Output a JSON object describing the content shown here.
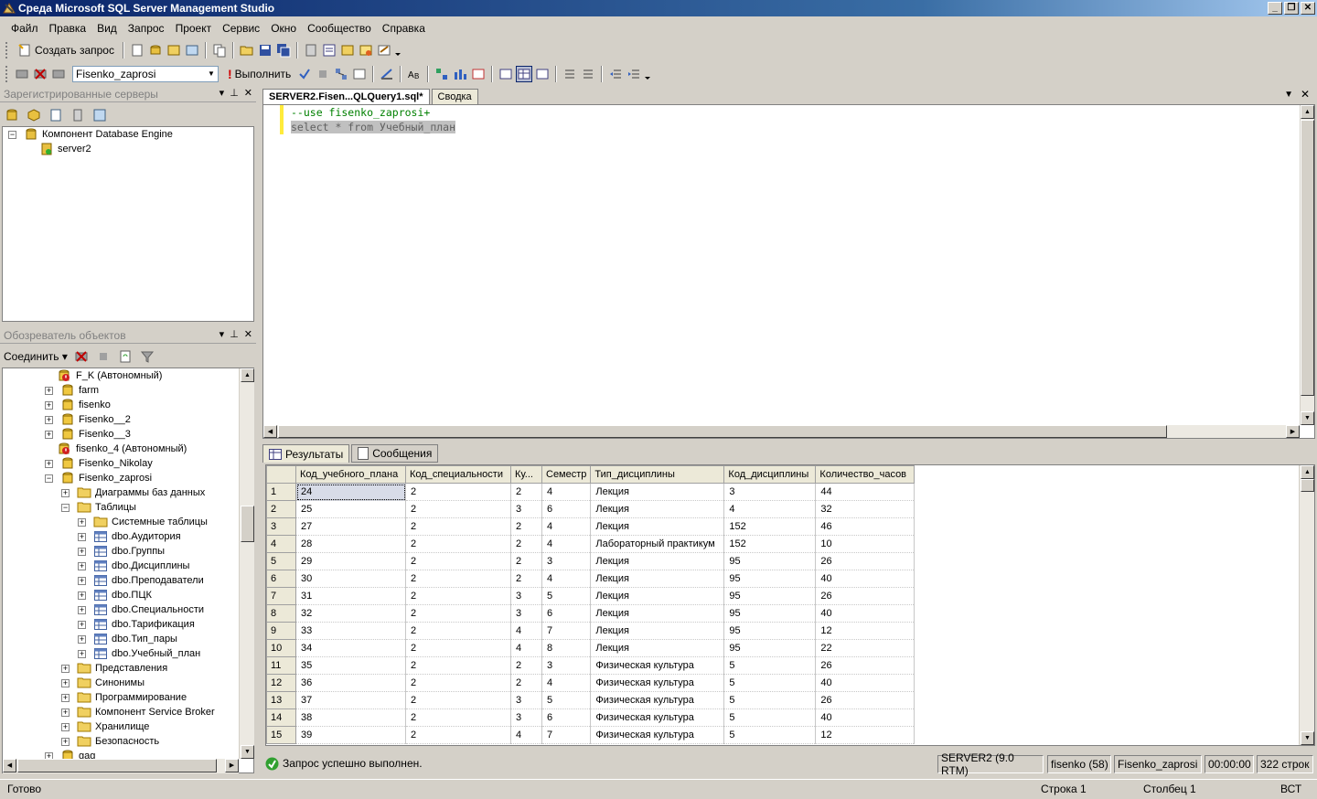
{
  "window": {
    "title": "Среда Microsoft SQL Server Management Studio"
  },
  "menu": [
    "Файл",
    "Правка",
    "Вид",
    "Запрос",
    "Проект",
    "Сервис",
    "Окно",
    "Сообщество",
    "Справка"
  ],
  "toolbar1": {
    "new_query": "Создать запрос"
  },
  "toolbar2": {
    "database": "Fisenko_zaprosi",
    "execute": "Выполнить"
  },
  "registered_servers": {
    "title": "Зарегистрированные серверы",
    "items": [
      {
        "label": "Компонент Database Engine",
        "expander": "−"
      },
      {
        "label": "server2",
        "expander": ""
      }
    ]
  },
  "object_explorer": {
    "title": "Обозреватель объектов",
    "connect": "Соединить",
    "items": [
      {
        "label": "F_K (Автономный)",
        "expander": "",
        "icon": "db-offline"
      },
      {
        "label": "farm",
        "expander": "+",
        "icon": "db"
      },
      {
        "label": "fisenko",
        "expander": "+",
        "icon": "db"
      },
      {
        "label": "Fisenko__2",
        "expander": "+",
        "icon": "db"
      },
      {
        "label": "Fisenko__3",
        "expander": "+",
        "icon": "db"
      },
      {
        "label": "fisenko_4 (Автономный)",
        "expander": "",
        "icon": "db-offline"
      },
      {
        "label": "Fisenko_Nikolay",
        "expander": "+",
        "icon": "db"
      },
      {
        "label": "Fisenko_zaprosi",
        "expander": "−",
        "icon": "db"
      },
      {
        "label": "Диаграммы баз данных",
        "expander": "+",
        "icon": "folder"
      },
      {
        "label": "Таблицы",
        "expander": "−",
        "icon": "folder"
      },
      {
        "label": "Системные таблицы",
        "expander": "+",
        "icon": "folder"
      },
      {
        "label": "dbo.Аудитория",
        "expander": "+",
        "icon": "table"
      },
      {
        "label": "dbo.Группы",
        "expander": "+",
        "icon": "table"
      },
      {
        "label": "dbo.Дисциплины",
        "expander": "+",
        "icon": "table"
      },
      {
        "label": "dbo.Преподаватели",
        "expander": "+",
        "icon": "table"
      },
      {
        "label": "dbo.ПЦК",
        "expander": "+",
        "icon": "table"
      },
      {
        "label": "dbo.Специальности",
        "expander": "+",
        "icon": "table"
      },
      {
        "label": "dbo.Тарификация",
        "expander": "+",
        "icon": "table"
      },
      {
        "label": "dbo.Тип_пары",
        "expander": "+",
        "icon": "table"
      },
      {
        "label": "dbo.Учебный_план",
        "expander": "+",
        "icon": "table"
      },
      {
        "label": "Представления",
        "expander": "+",
        "icon": "folder"
      },
      {
        "label": "Синонимы",
        "expander": "+",
        "icon": "folder"
      },
      {
        "label": "Программирование",
        "expander": "+",
        "icon": "folder"
      },
      {
        "label": "Компонент Service Broker",
        "expander": "+",
        "icon": "folder"
      },
      {
        "label": "Хранилище",
        "expander": "+",
        "icon": "folder"
      },
      {
        "label": "Безопасность",
        "expander": "+",
        "icon": "folder"
      },
      {
        "label": "gag",
        "expander": "+",
        "icon": "db"
      }
    ]
  },
  "editor": {
    "tabs": [
      "SERVER2.Fisen...QLQuery1.sql*",
      "Сводка"
    ],
    "lines": [
      "--use fisenko_zaprosi+",
      "select * from Учебный_план"
    ]
  },
  "results": {
    "tabs": [
      "Результаты",
      "Сообщения"
    ],
    "columns": [
      "Код_учебного_плана",
      "Код_специальности",
      "Ку...",
      "Семестр",
      "Тип_дисциплины",
      "Код_дисциплины",
      "Количество_часов"
    ],
    "rows": [
      [
        "1",
        "24",
        "2",
        "2",
        "4",
        "Лекция",
        "3",
        "44"
      ],
      [
        "2",
        "25",
        "2",
        "3",
        "6",
        "Лекция",
        "4",
        "32"
      ],
      [
        "3",
        "27",
        "2",
        "2",
        "4",
        "Лекция",
        "152",
        "46"
      ],
      [
        "4",
        "28",
        "2",
        "2",
        "4",
        "Лабораторный практикум",
        "152",
        "10"
      ],
      [
        "5",
        "29",
        "2",
        "2",
        "3",
        "Лекция",
        "95",
        "26"
      ],
      [
        "6",
        "30",
        "2",
        "2",
        "4",
        "Лекция",
        "95",
        "40"
      ],
      [
        "7",
        "31",
        "2",
        "3",
        "5",
        "Лекция",
        "95",
        "26"
      ],
      [
        "8",
        "32",
        "2",
        "3",
        "6",
        "Лекция",
        "95",
        "40"
      ],
      [
        "9",
        "33",
        "2",
        "4",
        "7",
        "Лекция",
        "95",
        "12"
      ],
      [
        "10",
        "34",
        "2",
        "4",
        "8",
        "Лекция",
        "95",
        "22"
      ],
      [
        "11",
        "35",
        "2",
        "2",
        "3",
        "Физическая культура",
        "5",
        "26"
      ],
      [
        "12",
        "36",
        "2",
        "2",
        "4",
        "Физическая культура",
        "5",
        "40"
      ],
      [
        "13",
        "37",
        "2",
        "3",
        "5",
        "Физическая культура",
        "5",
        "26"
      ],
      [
        "14",
        "38",
        "2",
        "3",
        "6",
        "Физическая культура",
        "5",
        "40"
      ],
      [
        "15",
        "39",
        "2",
        "4",
        "7",
        "Физическая культура",
        "5",
        "12"
      ]
    ]
  },
  "query_status": {
    "message": "Запрос успешно выполнен.",
    "server": "SERVER2 (9.0 RTM)",
    "user": "fisenko (58)",
    "database": "Fisenko_zaprosi",
    "time": "00:00:00",
    "rows": "322 строк"
  },
  "statusbar": {
    "ready": "Готово",
    "line": "Строка 1",
    "col": "Столбец 1",
    "mode": "ВСТ"
  }
}
